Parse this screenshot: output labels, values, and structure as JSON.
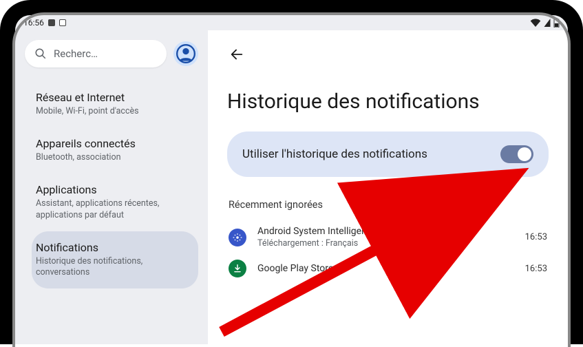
{
  "status": {
    "time": "16:56"
  },
  "sidebar": {
    "search_placeholder": "Recherc…",
    "items": [
      {
        "title": "Réseau et Internet",
        "sub": "Mobile, Wi-Fi, point d'accès"
      },
      {
        "title": "Appareils connectés",
        "sub": "Bluetooth, association"
      },
      {
        "title": "Applications",
        "sub": "Assistant, applications récentes, applications par défaut"
      },
      {
        "title": "Notifications",
        "sub": "Historique des notifications, conversations"
      }
    ],
    "selected_index": 3
  },
  "main": {
    "title": "Historique des notifications",
    "toggle_label": "Utiliser l'historique des notifications",
    "toggle_on": true,
    "section_header": "Récemment ignorées",
    "notifications": [
      {
        "app": "Android System Intelligence",
        "sub": "Téléchargement : Français",
        "time": "16:53",
        "icon": "gear"
      },
      {
        "app": "Google Play Store",
        "sub": "",
        "time": "16:53",
        "icon": "download"
      }
    ]
  }
}
